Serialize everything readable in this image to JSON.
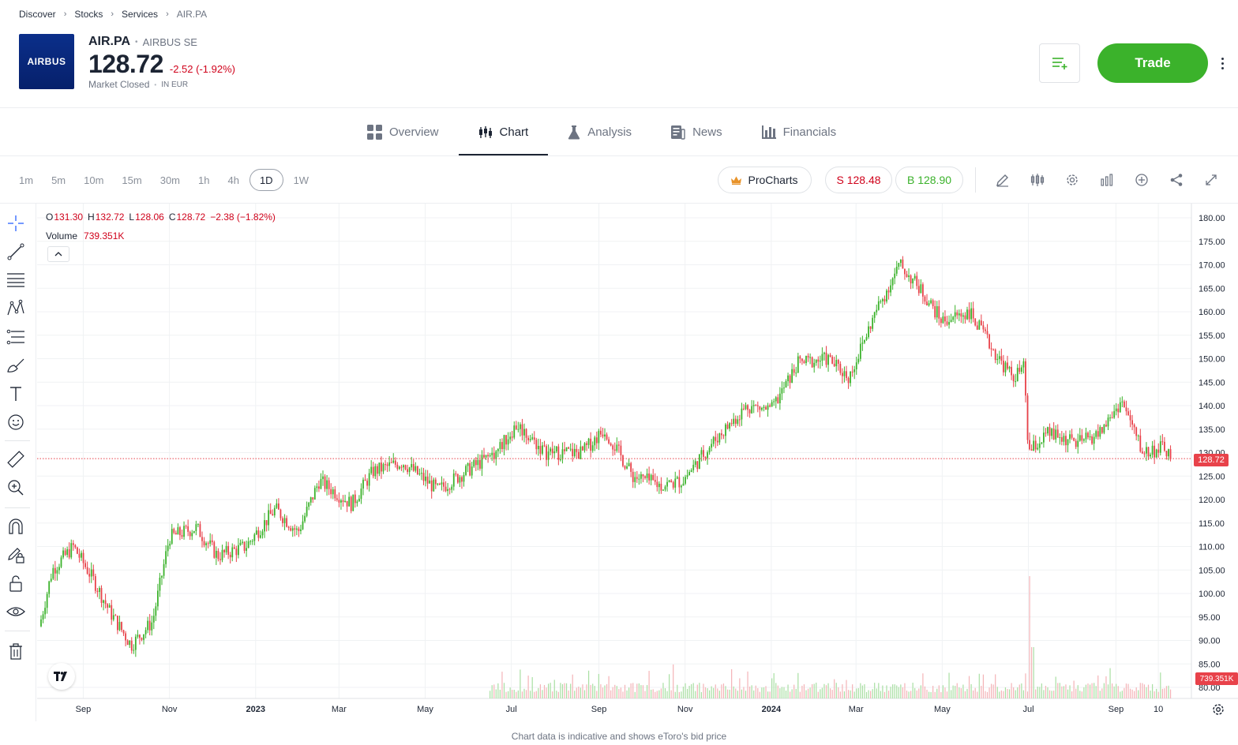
{
  "breadcrumb": [
    "Discover",
    "Stocks",
    "Services",
    "AIR.PA"
  ],
  "instrument": {
    "logo_text": "AIRBUS",
    "symbol": "AIR.PA",
    "name": "AIRBUS SE",
    "price": "128.72",
    "change": "-2.52 (-1.92%)",
    "market_status": "Market Closed",
    "currency": "IN EUR"
  },
  "actions": {
    "trade_label": "Trade"
  },
  "tabs": [
    {
      "label": "Overview",
      "icon": "grid-icon"
    },
    {
      "label": "Chart",
      "icon": "candlestick-icon",
      "active": true
    },
    {
      "label": "Analysis",
      "icon": "flask-icon"
    },
    {
      "label": "News",
      "icon": "newspaper-icon"
    },
    {
      "label": "Financials",
      "icon": "bar-chart-icon"
    }
  ],
  "intervals": [
    "1m",
    "5m",
    "10m",
    "15m",
    "30m",
    "1h",
    "4h",
    "1D",
    "1W"
  ],
  "active_interval": "1D",
  "toolbar": {
    "procharts_label": "ProCharts",
    "sell_label": "S 128.48",
    "buy_label": "B 128.90",
    "icons": [
      "pencil-icon",
      "candles-icon",
      "gear-icon",
      "indicators-icon",
      "add-circle-icon",
      "share-icon",
      "expand-icon"
    ]
  },
  "legend": {
    "o_key": "O",
    "o_val": "131.30",
    "h_key": "H",
    "h_val": "132.72",
    "l_key": "L",
    "l_val": "128.06",
    "c_key": "C",
    "c_val": "128.72",
    "change": "−2.38 (−1.82%)",
    "volume_label": "Volume",
    "volume_val": "739.351K"
  },
  "price_marker": "128.72",
  "volume_marker": "739.351K",
  "disclaimer": "Chart data is indicative and shows eToro's bid price",
  "colors": {
    "up": "#3bb22b",
    "down": "#e8424a",
    "accent_green": "#3bb22b",
    "accent_red": "#d0021b"
  },
  "chart_data": {
    "type": "candlestick",
    "y_ticks": [
      "180.00",
      "175.00",
      "170.00",
      "165.00",
      "160.00",
      "155.00",
      "150.00",
      "145.00",
      "140.00",
      "135.00",
      "130.00",
      "125.00",
      "120.00",
      "115.00",
      "110.00",
      "105.00",
      "100.00",
      "95.00",
      "90.00",
      "85.00",
      "80.00"
    ],
    "x_ticks": [
      "Sep",
      "Nov",
      "2023",
      "Mar",
      "May",
      "Jul",
      "Sep",
      "Nov",
      "2024",
      "Mar",
      "May",
      "Jul",
      "Sep",
      "10"
    ],
    "ylim": [
      80,
      180
    ],
    "last_price": 128.72,
    "path_points": [
      [
        "2022-08-01",
        93
      ],
      [
        "2022-08-10",
        105
      ],
      [
        "2022-08-25",
        110
      ],
      [
        "2022-09-08",
        103
      ],
      [
        "2022-09-20",
        96
      ],
      [
        "2022-10-05",
        89
      ],
      [
        "2022-10-20",
        94
      ],
      [
        "2022-11-01",
        112
      ],
      [
        "2022-11-20",
        114
      ],
      [
        "2022-12-05",
        108
      ],
      [
        "2022-12-25",
        110
      ],
      [
        "2023-01-15",
        118
      ],
      [
        "2023-01-31",
        113
      ],
      [
        "2023-02-15",
        124
      ],
      [
        "2023-03-10",
        119
      ],
      [
        "2023-03-25",
        126
      ],
      [
        "2023-04-15",
        128
      ],
      [
        "2023-05-10",
        122
      ],
      [
        "2023-05-30",
        126
      ],
      [
        "2023-06-20",
        130
      ],
      [
        "2023-07-05",
        136
      ],
      [
        "2023-07-25",
        130
      ],
      [
        "2023-08-20",
        130
      ],
      [
        "2023-09-05",
        135
      ],
      [
        "2023-09-25",
        125
      ],
      [
        "2023-10-15",
        123
      ],
      [
        "2023-10-30",
        124
      ],
      [
        "2023-11-20",
        132
      ],
      [
        "2023-12-15",
        140
      ],
      [
        "2024-01-01",
        139
      ],
      [
        "2024-01-20",
        149
      ],
      [
        "2024-02-10",
        150
      ],
      [
        "2024-02-25",
        146
      ],
      [
        "2024-03-15",
        160
      ],
      [
        "2024-04-01",
        170
      ],
      [
        "2024-04-15",
        165
      ],
      [
        "2024-05-01",
        158
      ],
      [
        "2024-05-20",
        160
      ],
      [
        "2024-06-10",
        150
      ],
      [
        "2024-06-20",
        146
      ],
      [
        "2024-06-28",
        148
      ],
      [
        "2024-07-01",
        130
      ],
      [
        "2024-07-15",
        134
      ],
      [
        "2024-08-05",
        132
      ],
      [
        "2024-08-20",
        134
      ],
      [
        "2024-09-05",
        141
      ],
      [
        "2024-09-20",
        130
      ],
      [
        "2024-10-05",
        131
      ],
      [
        "2024-10-11",
        128.72
      ]
    ]
  }
}
